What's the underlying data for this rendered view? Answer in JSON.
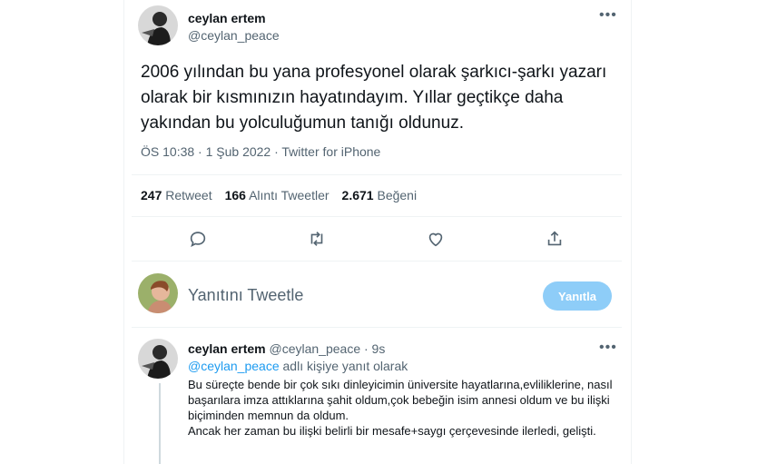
{
  "tweet": {
    "author_name": "ceylan ertem",
    "author_handle": "@ceylan_peace",
    "more_icon": "more-horizontal-icon",
    "text": "2006 yılından bu yana profesyonel olarak şarkıcı-şarkı yazarı olarak bir kısmınızın hayatındayım. Yıllar geçtikçe daha yakından bu yolculuğumun tanığı oldunuz.",
    "meta": "ÖS 10:38 · 1 Şub 2022 · Twitter for iPhone",
    "stats": {
      "retweets_count": "247",
      "retweets_label": "Retweet",
      "quotes_count": "166",
      "quotes_label": "Alıntı Tweetler",
      "likes_count": "2.671",
      "likes_label": "Beğeni"
    },
    "actions": [
      "reply-icon",
      "retweet-icon",
      "like-icon",
      "share-icon"
    ]
  },
  "composer": {
    "placeholder": "Yanıtını Tweetle",
    "button_label": "Yanıtla",
    "button_color": "#8ecdf8"
  },
  "reply": {
    "author_name": "ceylan ertem",
    "author_handle": "@ceylan_peace · 9s",
    "replying_prefix": "@ceylan_peace",
    "replying_suffix": " adlı kişiye yanıt olarak",
    "text": "Bu süreçte bende bir çok sıkı dinleyicimin üniversite hayatlarına,evliliklerine, nasıl başarılara imza attıklarına şahit oldum,çok bebeğin isim annesi oldum ve bu ilişki biçiminden memnun da oldum.\nAncak her zaman bu ilişki belirli bir mesafe+saygı çerçevesinde ilerledi, gelişti."
  },
  "colors": {
    "accent": "#1d9bf0",
    "secondary_text": "#536471",
    "divider": "#eff3f4"
  }
}
